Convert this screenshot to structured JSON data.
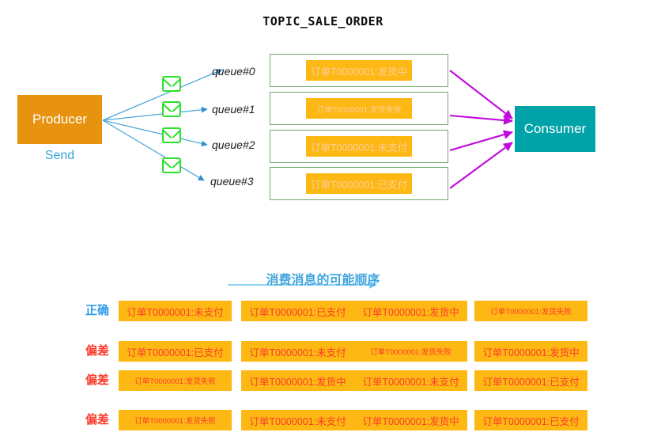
{
  "diagram": {
    "title": "TOPIC_SALE_ORDER",
    "producer": {
      "label": "Producer",
      "sublabel": "Send"
    },
    "consumer": {
      "label": "Consumer"
    },
    "queues": [
      {
        "label": "queue#0",
        "message": "订单T0000001:发货中",
        "size": "normal"
      },
      {
        "label": "queue#1",
        "message": "订单T0000001:发货失败",
        "size": "small"
      },
      {
        "label": "queue#2",
        "message": "订单T0000001:未支付",
        "size": "normal"
      },
      {
        "label": "queue#3",
        "message": "订单T0000001:已支付",
        "size": "normal"
      }
    ]
  },
  "order_section": {
    "heading": "消费消息的可能顺序",
    "rows": [
      {
        "label": "正确",
        "status": "correct",
        "cells": [
          {
            "text": "订单T0000001:未支付",
            "size": "normal"
          },
          {
            "text": "订单T0000001:已支付",
            "size": "normal"
          },
          {
            "text": "订单T0000001:发货中",
            "size": "normal"
          },
          {
            "text": "订单T0000001:发货失败",
            "size": "small"
          }
        ]
      },
      {
        "label": "偏差",
        "status": "deviation",
        "cells": [
          {
            "text": "订单T0000001:已支付",
            "size": "normal"
          },
          {
            "text": "订单T0000001:未支付",
            "size": "normal"
          },
          {
            "text": "订单T0000001:发货失败",
            "size": "small"
          },
          {
            "text": "订单T0000001:发货中",
            "size": "normal"
          }
        ]
      },
      {
        "label": "偏差",
        "status": "deviation",
        "cells": [
          {
            "text": "订单T0000001:发货失败",
            "size": "small"
          },
          {
            "text": "订单T0000001:发货中",
            "size": "normal"
          },
          {
            "text": "订单T0000001:未支付",
            "size": "normal"
          },
          {
            "text": "订单T0000001:已支付",
            "size": "normal"
          }
        ]
      },
      {
        "label": "偏差",
        "status": "deviation",
        "cells": [
          {
            "text": "订单T0000001:发货失败",
            "size": "small"
          },
          {
            "text": "订单T0000001:未支付",
            "size": "normal"
          },
          {
            "text": "订单T0000001:发货中",
            "size": "normal"
          },
          {
            "text": "订单T0000001:已支付",
            "size": "normal"
          }
        ]
      }
    ]
  },
  "icons": {
    "envelope": "envelope-icon",
    "arrow_right": "arrow-right-icon"
  },
  "colors": {
    "producer": "#E8930F",
    "consumer": "#00A3A8",
    "message_box": "#FDB813",
    "message_text": "#FFCE9B",
    "queue_border": "#6FA96F",
    "envelope": "#2BE02B",
    "send_arrow": "#3FA3DC",
    "consume_arrow": "#C109DE",
    "correct_label": "#2D9BE8",
    "deviation_label": "#FB3B2C",
    "heading": "#41A6DE"
  }
}
